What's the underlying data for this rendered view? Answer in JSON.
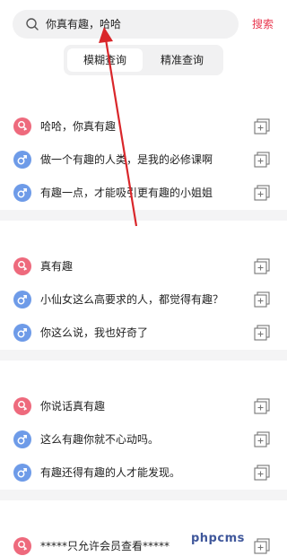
{
  "search": {
    "value": "你真有趣，哈哈",
    "button_label": "搜索"
  },
  "tabs": [
    {
      "label": "模糊查询",
      "active": true
    },
    {
      "label": "精准查询",
      "active": false
    }
  ],
  "groups": [
    {
      "rows": [
        {
          "gender": "female",
          "text": "哈哈，你真有趣"
        },
        {
          "gender": "male",
          "text": "做一个有趣的人类，是我的必修课啊"
        },
        {
          "gender": "male",
          "text": "有趣一点，才能吸引更有趣的小姐姐"
        }
      ]
    },
    {
      "rows": [
        {
          "gender": "female",
          "text": "真有趣"
        },
        {
          "gender": "male",
          "text": "小仙女这么高要求的人，都觉得有趣？"
        },
        {
          "gender": "male",
          "text": "你这么说，我也好奇了"
        }
      ]
    },
    {
      "rows": [
        {
          "gender": "female",
          "text": "你说话真有趣"
        },
        {
          "gender": "male",
          "text": "这么有趣你就不心动吗。"
        },
        {
          "gender": "male",
          "text": "有趣还得有趣的人才能发现。"
        }
      ]
    },
    {
      "rows": [
        {
          "gender": "female",
          "text": "*****只允许会员查看*****"
        }
      ]
    }
  ],
  "watermark": "phpcms",
  "colors": {
    "accent": "#e8384f",
    "female": "#ee6a7d",
    "male": "#6e9be8",
    "annotation_arrow": "#d9262a"
  }
}
